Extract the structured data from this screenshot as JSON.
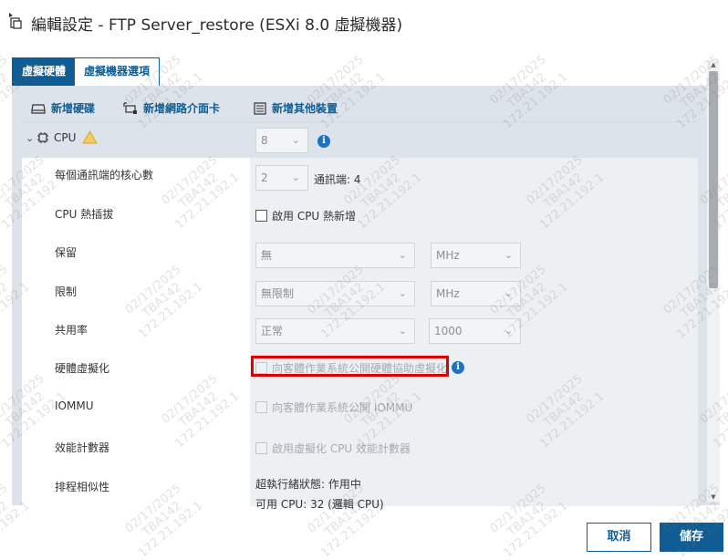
{
  "dialog": {
    "title": "編輯設定 - FTP Server_restore (ESXi 8.0 虛擬機器)"
  },
  "tabs": [
    {
      "label": "虛擬硬體",
      "active": true
    },
    {
      "label": "虛擬機器選項",
      "active": false
    }
  ],
  "actions": {
    "add_disk": "新增硬碟",
    "add_nic": "新增網路介面卡",
    "add_other": "新增其他裝置"
  },
  "cpu": {
    "label": "CPU",
    "count": "8",
    "cores_label": "每個通訊端的核心數",
    "cores_value": "2",
    "sockets_text": "通訊端: 4",
    "hotplug_label": "CPU 熱插拔",
    "hotplug_checkbox": "啟用 CPU 熱新增",
    "reservation_label": "保留",
    "reservation_value": "無",
    "reservation_unit": "MHz",
    "limit_label": "限制",
    "limit_value": "無限制",
    "limit_unit": "MHz",
    "shares_label": "共用率",
    "shares_value": "正常",
    "shares_number": "1000",
    "hwvirt_label": "硬體虛擬化",
    "hwvirt_checkbox": "向客體作業系統公開硬體協助虛擬化",
    "iommu_label": "IOMMU",
    "iommu_checkbox": "向客體作業系統公開 IOMMU",
    "perf_label": "效能計數器",
    "perf_checkbox": "啟用虛擬化 CPU 效能計數器",
    "affinity_label": "排程相似性",
    "affinity_line1": "超執行緒狀態: 作用中",
    "affinity_line2": "可用 CPU: 32 (邏輯 CPU)"
  },
  "footer": {
    "cancel": "取消",
    "save": "儲存"
  },
  "watermark": {
    "date": "02/17/2025",
    "user": "TBA142",
    "ip": "172.21.192.1"
  },
  "colors": {
    "accent": "#0f5d94",
    "highlight": "#e00000",
    "warning": "#f0c040",
    "info": "#1b73c7"
  }
}
